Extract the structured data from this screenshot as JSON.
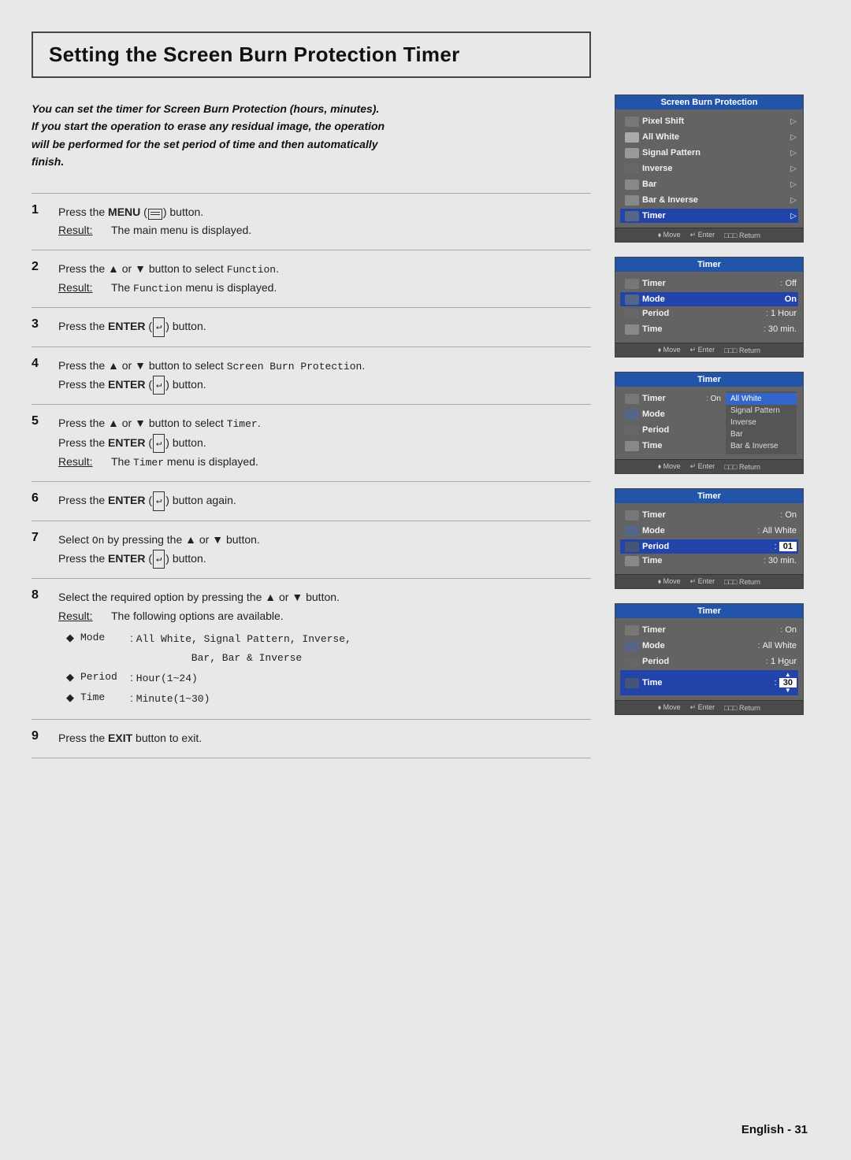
{
  "page": {
    "title": "Setting the Screen Burn Protection Timer",
    "intro": "You can set the timer for Screen Burn Protection (hours, minutes).\nIf you start the operation to erase any residual image, the operation\nwill be performed for the set period of time and then automatically\nfinish.",
    "footer": "English - 31"
  },
  "steps": [
    {
      "num": "1",
      "text": "Press the MENU (□□□) button.",
      "result": "The main menu is displayed."
    },
    {
      "num": "2",
      "text": "Press the ▲ or ▼ button to select Function.",
      "result": "The Function menu is displayed."
    },
    {
      "num": "3",
      "text": "Press the ENTER (↵) button."
    },
    {
      "num": "4",
      "text": "Press the ▲ or ▼ button to select Screen Burn Protection.\nPress the ENTER (↵) button."
    },
    {
      "num": "5",
      "text": "Press the ▲ or ▼ button to select Timer.\nPress the ENTER (↵) button.",
      "result": "The Timer menu is displayed."
    },
    {
      "num": "6",
      "text": "Press the ENTER (↵) button again."
    },
    {
      "num": "7",
      "text": "Select On by pressing the ▲ or ▼ button.\nPress the ENTER (↵) button."
    },
    {
      "num": "8",
      "text": "Select the required option by pressing the ▲ or ▼ button.",
      "result": "The following options are available.",
      "bullets": [
        {
          "label": "Mode",
          "value": ": All White, Signal Pattern, Inverse,\n  Bar, Bar & Inverse"
        },
        {
          "label": "Period",
          "value": ": Hour(1~24)"
        },
        {
          "label": "Time",
          "value": ": Minute(1~30)"
        }
      ]
    },
    {
      "num": "9",
      "text": "Press the EXIT button to exit."
    }
  ],
  "screens": [
    {
      "id": "screen1",
      "title": "Screen Burn Protection",
      "rows": [
        {
          "icon": "pixel",
          "label": "Pixel Shift",
          "arrow": "▷",
          "highlight": false
        },
        {
          "icon": "white",
          "label": "All White",
          "arrow": "▷",
          "highlight": false
        },
        {
          "icon": "signal",
          "label": "Signal Pattern",
          "arrow": "▷",
          "highlight": false
        },
        {
          "icon": "inverse",
          "label": "Inverse",
          "arrow": "▷",
          "highlight": false
        },
        {
          "icon": "bar",
          "label": "Bar",
          "arrow": "▷",
          "highlight": false
        },
        {
          "icon": "barinv",
          "label": "Bar & Inverse",
          "arrow": "▷",
          "highlight": false
        },
        {
          "icon": "timer",
          "label": "Timer",
          "arrow": "▷",
          "highlight": true
        }
      ],
      "footer": [
        "Move",
        "Enter",
        "Return"
      ]
    },
    {
      "id": "screen2",
      "title": "Timer",
      "fields": [
        {
          "label": "Timer",
          "sep": ":",
          "value": "Off",
          "valueStyle": "normal"
        },
        {
          "label": "Mode",
          "sep": "",
          "value": "On",
          "valueStyle": "highlighted"
        },
        {
          "label": "Period",
          "sep": ":",
          "value": "1 Hour",
          "valueStyle": "normal"
        },
        {
          "label": "Time",
          "sep": ":",
          "value": "30 min.",
          "valueStyle": "normal"
        }
      ],
      "footer": [
        "Move",
        "Enter",
        "Return"
      ]
    },
    {
      "id": "screen3",
      "title": "Timer",
      "fields": [
        {
          "label": "Timer",
          "sep": ":",
          "value": "On",
          "valueStyle": "normal"
        },
        {
          "label": "Mode",
          "sep": "",
          "value": "",
          "valueStyle": "normal"
        },
        {
          "label": "Period",
          "sep": ":",
          "value": "",
          "valueStyle": "normal"
        },
        {
          "label": "Time",
          "sep": ":",
          "value": "",
          "valueStyle": "normal"
        }
      ],
      "options": [
        "All White",
        "Signal Pattern",
        "Inverse",
        "Bar",
        "Bar & Inverse"
      ],
      "selectedOption": "All White",
      "footer": [
        "Move",
        "Enter",
        "Return"
      ]
    },
    {
      "id": "screen4",
      "title": "Timer",
      "fields": [
        {
          "label": "Timer",
          "sep": ":",
          "value": "On",
          "valueStyle": "normal"
        },
        {
          "label": "Mode",
          "sep": ":",
          "value": "All White",
          "valueStyle": "normal"
        },
        {
          "label": "Period",
          "sep": ":",
          "value": "01",
          "valueStyle": "boxed"
        },
        {
          "label": "Time",
          "sep": ":",
          "value": "30 min.",
          "valueStyle": "normal"
        }
      ],
      "footer": [
        "Move",
        "Enter",
        "Return"
      ]
    },
    {
      "id": "screen5",
      "title": "Timer",
      "fields": [
        {
          "label": "Timer",
          "sep": ":",
          "value": "On",
          "valueStyle": "normal"
        },
        {
          "label": "Mode",
          "sep": ":",
          "value": "All White",
          "valueStyle": "normal"
        },
        {
          "label": "Period",
          "sep": ":",
          "value": "1 Hour",
          "valueStyle": "normal"
        },
        {
          "label": "Time",
          "sep": ":",
          "value": "30",
          "valueStyle": "boxed-up"
        }
      ],
      "footer": [
        "Move",
        "Enter",
        "Return"
      ]
    }
  ]
}
